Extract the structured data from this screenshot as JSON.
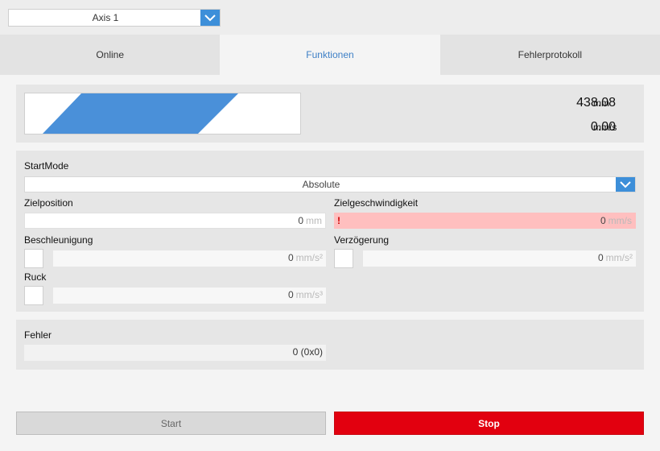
{
  "axis_selector": {
    "value": "Axis 1"
  },
  "tabs": [
    {
      "label": "Online",
      "active": false
    },
    {
      "label": "Funktionen",
      "active": true
    },
    {
      "label": "Fehlerprotokoll",
      "active": false
    }
  ],
  "display": {
    "position_value": "438.08",
    "position_unit": "mm",
    "velocity_value": "0.00",
    "velocity_unit": "mm/s",
    "bar_color": "#4a90d9"
  },
  "form": {
    "startmode": {
      "label": "StartMode",
      "value": "Absolute"
    },
    "zielposition": {
      "label": "Zielposition",
      "value": "0",
      "unit": "mm"
    },
    "zielgeschwindigkeit": {
      "label": "Zielgeschwindigkeit",
      "value": "0",
      "unit": "mm/s",
      "error_mark": "!"
    },
    "beschleunigung": {
      "label": "Beschleunigung",
      "value": "0",
      "unit": "mm/s²"
    },
    "verzoegerung": {
      "label": "Verzögerung",
      "value": "0",
      "unit": "mm/s²"
    },
    "ruck": {
      "label": "Ruck",
      "value": "0",
      "unit": "mm/s³"
    }
  },
  "fehler": {
    "label": "Fehler",
    "value": "0 (0x0)"
  },
  "buttons": {
    "start": "Start",
    "stop": "Stop"
  },
  "colors": {
    "accent": "#3d8fd9",
    "stop": "#e2000f",
    "error_field": "#ffbfbf"
  }
}
